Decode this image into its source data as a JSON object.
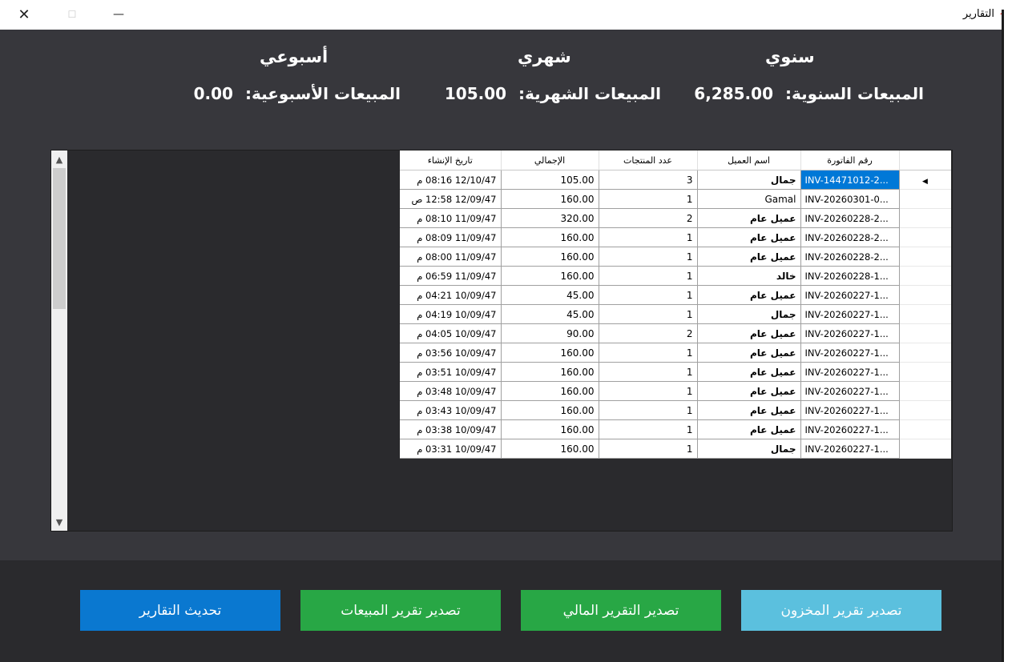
{
  "window": {
    "title": "التقارير",
    "close_glyph": "✕",
    "maximize_glyph": "☐",
    "minimize_glyph": "—"
  },
  "stats": {
    "yearly": {
      "heading": "سنوي",
      "label": "المبيعات السنوية:",
      "value": "6,285.00"
    },
    "monthly": {
      "heading": "شهري",
      "label": "المبيعات الشهرية:",
      "value": "105.00"
    },
    "weekly": {
      "heading": "أسبوعي",
      "label": "المبيعات الأسبوعية:",
      "value": "0.00"
    }
  },
  "table": {
    "columns": {
      "invoice": "رقم الفاتورة",
      "customer": "اسم العميل",
      "count": "عدد المنتجات",
      "total": "الإجمالي",
      "created": "تاريخ الإنشاء"
    },
    "rows": [
      {
        "invoice": "INV-14471012-2...",
        "customer": "جمال",
        "count": "3",
        "total": "105.00",
        "created": "12/10/47 08:16 م"
      },
      {
        "invoice": "INV-20260301-0...",
        "customer": "Gamal",
        "count": "1",
        "total": "160.00",
        "created": "12/09/47 12:58 ص"
      },
      {
        "invoice": "INV-20260228-2...",
        "customer": "عميل عام",
        "count": "2",
        "total": "320.00",
        "created": "11/09/47 08:10 م"
      },
      {
        "invoice": "INV-20260228-2...",
        "customer": "عميل عام",
        "count": "1",
        "total": "160.00",
        "created": "11/09/47 08:09 م"
      },
      {
        "invoice": "INV-20260228-2...",
        "customer": "عميل عام",
        "count": "1",
        "total": "160.00",
        "created": "11/09/47 08:00 م"
      },
      {
        "invoice": "INV-20260228-1...",
        "customer": "خالد",
        "count": "1",
        "total": "160.00",
        "created": "11/09/47 06:59 م"
      },
      {
        "invoice": "INV-20260227-1...",
        "customer": "عميل عام",
        "count": "1",
        "total": "45.00",
        "created": "10/09/47 04:21 م"
      },
      {
        "invoice": "INV-20260227-1...",
        "customer": "جمال",
        "count": "1",
        "total": "45.00",
        "created": "10/09/47 04:19 م"
      },
      {
        "invoice": "INV-20260227-1...",
        "customer": "عميل عام",
        "count": "2",
        "total": "90.00",
        "created": "10/09/47 04:05 م"
      },
      {
        "invoice": "INV-20260227-1...",
        "customer": "عميل عام",
        "count": "1",
        "total": "160.00",
        "created": "10/09/47 03:56 م"
      },
      {
        "invoice": "INV-20260227-1...",
        "customer": "عميل عام",
        "count": "1",
        "total": "160.00",
        "created": "10/09/47 03:51 م"
      },
      {
        "invoice": "INV-20260227-1...",
        "customer": "عميل عام",
        "count": "1",
        "total": "160.00",
        "created": "10/09/47 03:48 م"
      },
      {
        "invoice": "INV-20260227-1...",
        "customer": "عميل عام",
        "count": "1",
        "total": "160.00",
        "created": "10/09/47 03:43 م"
      },
      {
        "invoice": "INV-20260227-1...",
        "customer": "عميل عام",
        "count": "1",
        "total": "160.00",
        "created": "10/09/47 03:38 م"
      },
      {
        "invoice": "INV-20260227-1...",
        "customer": "جمال",
        "count": "1",
        "total": "160.00",
        "created": "10/09/47 03:31 م"
      }
    ]
  },
  "buttons": {
    "refresh": "تحديث التقارير",
    "export_sales": "تصدير تقرير المبيعات",
    "export_financial": "تصدير التقرير المالي",
    "export_inventory": "تصدير تقرير المخزون"
  },
  "colors": {
    "refresh": "#0a78d0",
    "export_sales": "#28a745",
    "export_financial": "#28a745",
    "export_inventory": "#5bc0de"
  },
  "icons": {
    "app": "house-icon",
    "row_pointer": "▶",
    "scroll_up": "▲",
    "scroll_down": "▼"
  }
}
